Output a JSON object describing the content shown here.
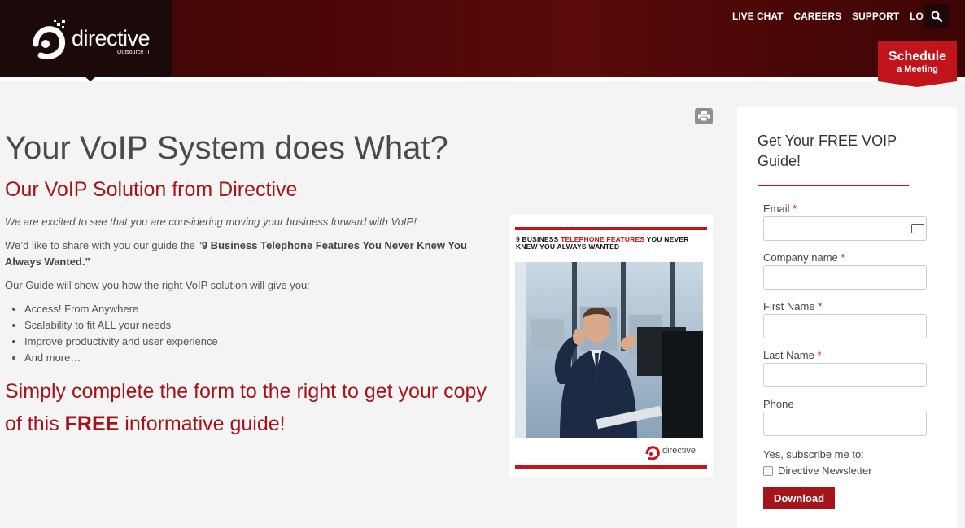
{
  "header": {
    "logo_text": "directive",
    "logo_sub": "Outsource IT",
    "nav": [
      "LIVE CHAT",
      "CAREERS",
      "SUPPORT",
      "LOGIN"
    ],
    "schedule_line1": "Schedule",
    "schedule_line2": "a Meeting"
  },
  "main": {
    "title": "Your VoIP System does What?",
    "subtitle": "Our VoIP Solution from Directive",
    "intro": "We are excited to see that you are considering moving your business forward with VoIP!",
    "share_prefix": "We’d like to share with you our guide the “",
    "share_bold": "9 Business Telephone Features You Never Knew You Always Wanted.”",
    "guide_lead": "Our Guide will show you how the right VoIP solution will give you:",
    "bullets": [
      "Access! From Anywhere",
      "Scalability to fit ALL your needs",
      "Improve productivity and user experience",
      "And more…"
    ],
    "cta_prefix": "Simply complete the form to the right to get your copy of this ",
    "cta_bold": "FREE",
    "cta_suffix": " informative guide!"
  },
  "cover": {
    "title_prefix": "9 BUSINESS ",
    "title_red": "TELEPHONE FEATURES",
    "title_suffix": " YOU NEVER KNEW YOU ALWAYS WANTED",
    "logo_text": "directive"
  },
  "form": {
    "title": "Get Your FREE VOIP Guide!",
    "email_label": "Email",
    "company_label": "Company name",
    "first_label": "First Name",
    "last_label": "Last Name",
    "phone_label": "Phone",
    "required_mark": "*",
    "subscribe_label": "Yes, subscribe me to:",
    "newsletter_label": "Directive Newsletter",
    "download_label": "Download"
  },
  "colors": {
    "brand_red": "#c0161b",
    "header_dark": "#4a0606"
  }
}
